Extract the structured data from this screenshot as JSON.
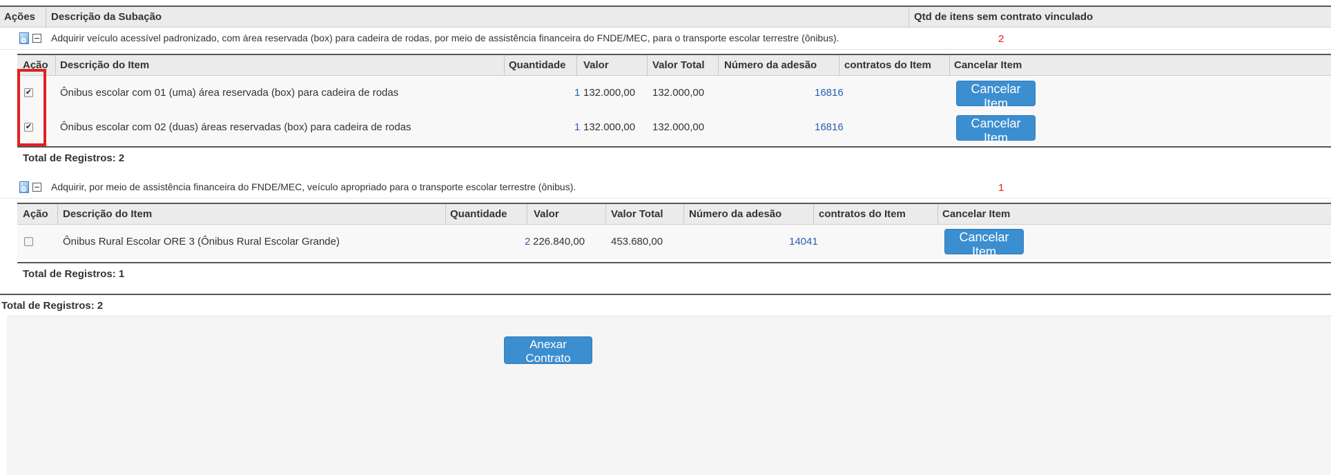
{
  "header": {
    "col_acoes": "Ações",
    "col_descricao": "Descrição da Subação",
    "col_qtd": "Qtd de itens sem contrato vinculado"
  },
  "item_headers": {
    "acao": "Ação",
    "descricao": "Descrição do Item",
    "quantidade": "Quantidade",
    "valor": "Valor",
    "valor_total": "Valor Total",
    "numero_adesao": "Número da adesão",
    "contratos": "contratos do Item",
    "cancelar": "Cancelar Item"
  },
  "subacoes": [
    {
      "descricao": "Adquirir veículo acessível padronizado, com área reservada (box) para cadeira de rodas, por meio de assistência financeira do FNDE/MEC, para o transporte escolar terrestre (ônibus).",
      "qtd_sem_contrato": "2",
      "items": [
        {
          "checked": true,
          "descricao": "Ônibus escolar com 01 (uma) área reservada (box) para cadeira de rodas",
          "quantidade": "1",
          "valor": "132.000,00",
          "valor_total": "132.000,00",
          "numero_adesao": "16816",
          "contratos": "",
          "button_label": "Cancelar Item"
        },
        {
          "checked": true,
          "descricao": "Ônibus escolar com 02 (duas) áreas reservadas (box) para cadeira de rodas",
          "quantidade": "1",
          "valor": "132.000,00",
          "valor_total": "132.000,00",
          "numero_adesao": "16816",
          "contratos": "",
          "button_label": "Cancelar Item"
        }
      ],
      "total_label": "Total de Registros: 2"
    },
    {
      "descricao": "Adquirir, por meio de assistência financeira do FNDE/MEC, veículo apropriado para o transporte escolar terrestre (ônibus).",
      "qtd_sem_contrato": "1",
      "items": [
        {
          "checked": false,
          "descricao": "Ônibus Rural Escolar ORE 3 (Ônibus Rural Escolar Grande)",
          "quantidade": "2",
          "valor": "226.840,00",
          "valor_total": "453.680,00",
          "numero_adesao": "14041",
          "contratos": "",
          "button_label": "Cancelar Item"
        }
      ],
      "total_label": "Total de Registros: 1"
    }
  ],
  "outer_total": "Total de Registros: 2",
  "anexar_button": "Anexar Contrato",
  "icons": {
    "doc": "document-search-icon",
    "collapse": "minus-square-icon",
    "checkbox": "checkbox-icon"
  },
  "colors": {
    "button_bg": "#3b8ed0",
    "link": "#2a5db0",
    "count_red": "#e02020",
    "highlight": "#e02020"
  }
}
